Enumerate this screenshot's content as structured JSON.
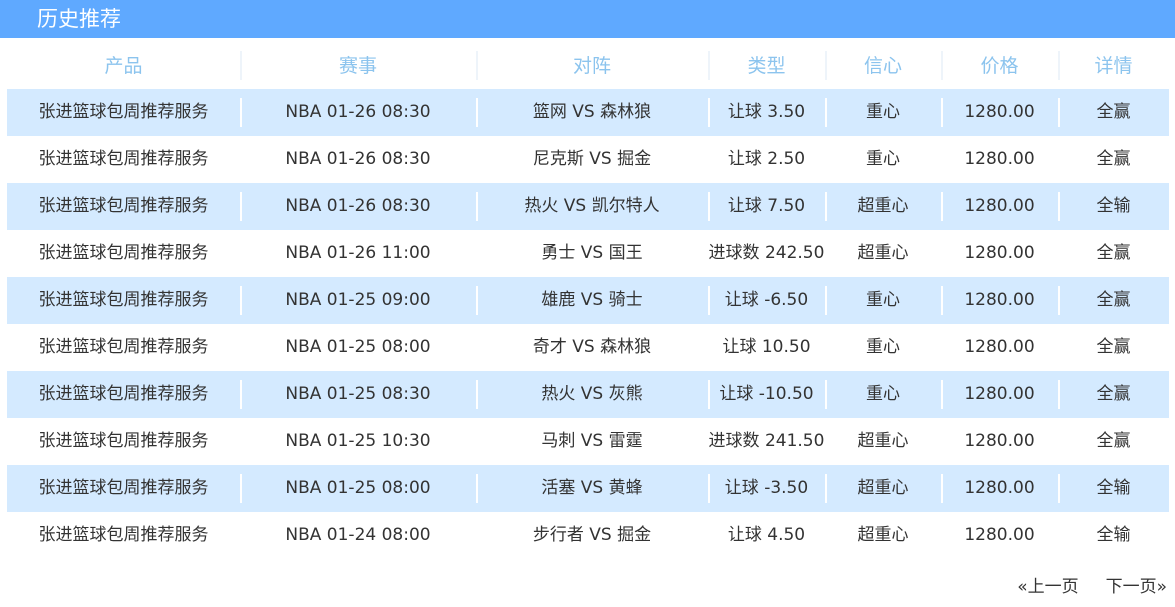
{
  "header": {
    "title": "历史推荐"
  },
  "columns": [
    "产品",
    "赛事",
    "对阵",
    "类型",
    "信心",
    "价格",
    "详情"
  ],
  "rows": [
    {
      "product": "张进篮球包周推荐服务",
      "match": "NBA 01-26 08:30",
      "matchup": "篮网 VS 森林狼",
      "type": "让球 3.50",
      "confidence": "重心",
      "price": "1280.00",
      "result": "全赢"
    },
    {
      "product": "张进篮球包周推荐服务",
      "match": "NBA 01-26 08:30",
      "matchup": "尼克斯 VS 掘金",
      "type": "让球 2.50",
      "confidence": "重心",
      "price": "1280.00",
      "result": "全赢"
    },
    {
      "product": "张进篮球包周推荐服务",
      "match": "NBA 01-26 08:30",
      "matchup": "热火 VS 凯尔特人",
      "type": "让球 7.50",
      "confidence": "超重心",
      "price": "1280.00",
      "result": "全输"
    },
    {
      "product": "张进篮球包周推荐服务",
      "match": "NBA 01-26 11:00",
      "matchup": "勇士 VS 国王",
      "type": "进球数 242.50",
      "confidence": "超重心",
      "price": "1280.00",
      "result": "全赢"
    },
    {
      "product": "张进篮球包周推荐服务",
      "match": "NBA 01-25 09:00",
      "matchup": "雄鹿 VS 骑士",
      "type": "让球 -6.50",
      "confidence": "重心",
      "price": "1280.00",
      "result": "全赢"
    },
    {
      "product": "张进篮球包周推荐服务",
      "match": "NBA 01-25 08:00",
      "matchup": "奇才 VS 森林狼",
      "type": "让球 10.50",
      "confidence": "重心",
      "price": "1280.00",
      "result": "全赢"
    },
    {
      "product": "张进篮球包周推荐服务",
      "match": "NBA 01-25 08:30",
      "matchup": "热火 VS 灰熊",
      "type": "让球 -10.50",
      "confidence": "重心",
      "price": "1280.00",
      "result": "全赢"
    },
    {
      "product": "张进篮球包周推荐服务",
      "match": "NBA 01-25 10:30",
      "matchup": "马刺 VS 雷霆",
      "type": "进球数 241.50",
      "confidence": "超重心",
      "price": "1280.00",
      "result": "全赢"
    },
    {
      "product": "张进篮球包周推荐服务",
      "match": "NBA 01-25 08:00",
      "matchup": "活塞 VS 黄蜂",
      "type": "让球 -3.50",
      "confidence": "超重心",
      "price": "1280.00",
      "result": "全输"
    },
    {
      "product": "张进篮球包周推荐服务",
      "match": "NBA 01-24 08:00",
      "matchup": "步行者 VS 掘金",
      "type": "让球 4.50",
      "confidence": "超重心",
      "price": "1280.00",
      "result": "全输"
    }
  ],
  "pager": {
    "prev": "«上一页",
    "next": "下一页»"
  },
  "colors": {
    "header_bg": "#5fa9ff",
    "row_alt": "#d4eaff",
    "column_header": "#8cc4ee"
  }
}
